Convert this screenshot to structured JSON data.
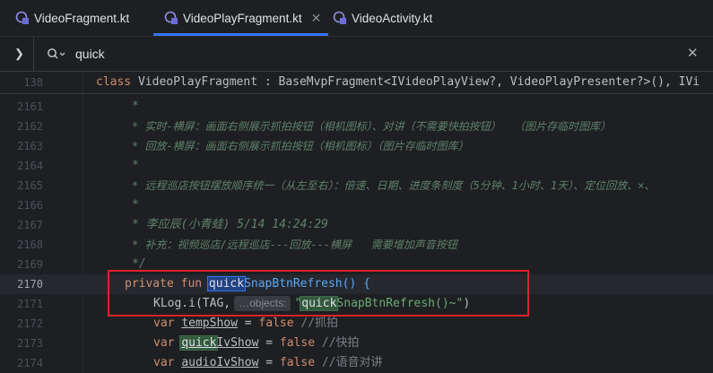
{
  "tabs": [
    {
      "label": "VideoFragment.kt",
      "active": false
    },
    {
      "label": "VideoPlayFragment.kt",
      "active": true
    },
    {
      "label": "VideoActivity.kt",
      "active": false
    }
  ],
  "find": {
    "query": "quick",
    "expand_icon": "chevron-right-icon",
    "search_icon": "search-icon"
  },
  "sticky": {
    "line_no": "138",
    "kw_class": "class",
    "rest": " VideoPlayFragment : BaseMvpFragment<IVideoPlayView?, VideoPlayPresenter?>(), IVi"
  },
  "lines": {
    "l2161": {
      "no": "2161",
      "text": "*"
    },
    "l2162": {
      "no": "2162",
      "text": "* 实时-横屏：画面右侧展示抓拍按钮（相机图标）、对讲（不需要快拍按钮）  （图片存临时图库）"
    },
    "l2163": {
      "no": "2163",
      "text": "* 回放-横屏：画面右侧展示抓拍按钮（相机图标）（图片存临时图库）"
    },
    "l2164": {
      "no": "2164",
      "text": "*"
    },
    "l2165": {
      "no": "2165",
      "text": "* 远程巡店按钮摆放顺序统一（从左至右）：倍速、日期、进度条刻度（5分钟、1小时、1天）、定位回放、×、"
    },
    "l2166": {
      "no": "2166",
      "text": "*"
    },
    "l2167": {
      "no": "2167",
      "text": "* 李应辰(小青蛙) 5/14 14:24:29"
    },
    "l2168": {
      "no": "2168",
      "text": "* 补充：视频巡店/远程巡店---回放---横屏   需要增加声音按钮"
    },
    "l2169": {
      "no": "2169",
      "text": "*/"
    },
    "l2170": {
      "no": "2170",
      "kw1": "private fun ",
      "match": "quick",
      "rest": "SnapBtnRefresh() {"
    },
    "l2171": {
      "no": "2171",
      "pre": "KLog.i(TAG,",
      "hint": "…objects:",
      "str_open": "\"",
      "match": "quick",
      "str_rest": "SnapBtnRefresh()~\"",
      "close": ")"
    },
    "l2172": {
      "no": "2172",
      "kw": "var ",
      "name": "tempShow",
      "eq": " = ",
      "val": "false",
      "comment": " //抓拍"
    },
    "l2173": {
      "no": "2173",
      "kw": "var ",
      "match": "quick",
      "name": "IvShow",
      "eq": " = ",
      "val": "false",
      "comment": " //快拍"
    },
    "l2174": {
      "no": "2174",
      "kw": "var ",
      "name": "audioIvShow",
      "eq": " = ",
      "val": "false",
      "comment": " //语音对讲"
    }
  },
  "colors": {
    "accent": "#3574f0",
    "highlight_box": "#e0212b",
    "match_bg": "#32593d"
  }
}
